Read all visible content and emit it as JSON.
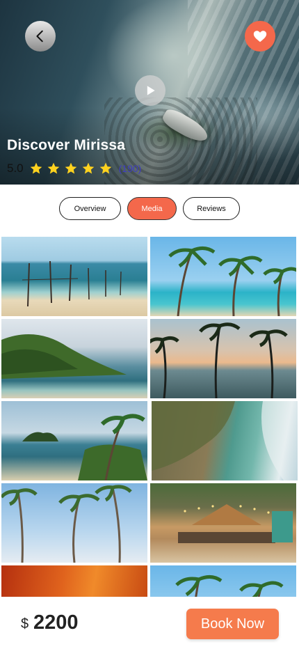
{
  "hero": {
    "title": "Discover Mirissa",
    "rating": "5.0",
    "stars": 5,
    "review_count": "(190)",
    "icons": {
      "back": "chevron-left-icon",
      "favorite": "heart-icon",
      "play": "play-icon",
      "star": "star-icon"
    }
  },
  "tabs": [
    {
      "label": "Overview",
      "active": false
    },
    {
      "label": "Media",
      "active": true
    },
    {
      "label": "Reviews",
      "active": false
    }
  ],
  "gallery": {
    "photos": [
      "fishing-stilts-beach",
      "palm-trees-lagoon",
      "green-headland-sea",
      "palm-silhouettes-sunset",
      "rock-island-palms",
      "aerial-cove-reef",
      "tall-palms-sky",
      "beach-restaurant-lights",
      "orange-sunset-clouds",
      "palm-trees-blue-sea"
    ]
  },
  "footer": {
    "currency": "$",
    "price": "2200",
    "book_label": "Book Now"
  },
  "colors": {
    "accent": "#f4684b",
    "book_button": "#f57b4c",
    "review_count": "#3e3dbf",
    "star": "#ffd21f"
  }
}
